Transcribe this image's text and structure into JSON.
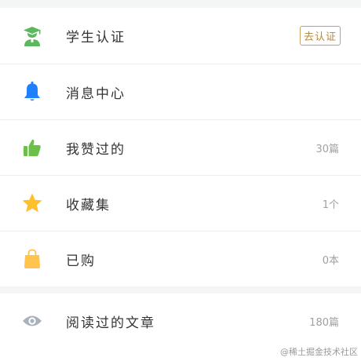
{
  "menu": {
    "rows": [
      {
        "label": "学生认证",
        "badge": "去认证",
        "icon": "student-cap-icon",
        "icon_color": "#5cb85c"
      },
      {
        "label": "消息中心",
        "icon": "bell-icon",
        "icon_color": "#1e80ff"
      },
      {
        "label": "我赞过的",
        "value": "30篇",
        "icon": "thumbs-up-icon",
        "icon_color": "#6cc04a"
      },
      {
        "label": "收藏集",
        "value": "1个",
        "icon": "star-icon",
        "icon_color": "#ffc02d"
      },
      {
        "label": "已购",
        "value": "0本",
        "icon": "shopping-bag-icon",
        "icon_color": "#ffc44d"
      },
      {
        "label": "阅读过的文章",
        "value": "180篇",
        "icon": "eye-icon",
        "icon_color": "#a9b1ba"
      }
    ]
  },
  "watermark": "@稀土掘金技术社区",
  "colors": {
    "background": "#f4f5f5",
    "badge": "#b7893a"
  }
}
